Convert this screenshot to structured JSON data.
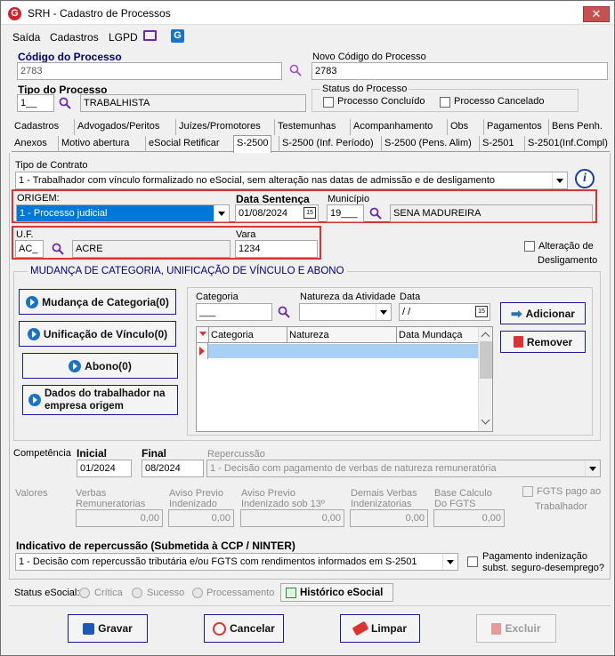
{
  "window": {
    "title": "SRH - Cadastro de Processos",
    "close_icon": "✕"
  },
  "menu": [
    "Saída",
    "Cadastros",
    "LGPD"
  ],
  "header": {
    "codigo_label": "Código do Processo",
    "codigo_value": "2783",
    "novo_codigo_label": "Novo Código do Processo",
    "novo_codigo_value": "2783",
    "tipo_label": "Tipo do Processo",
    "tipo_code": "1__",
    "tipo_desc": "TRABALHISTA",
    "status_label": "Status do Processo",
    "status_concluido": "Processo Concluído",
    "status_cancelado": "Processo Cancelado"
  },
  "tabs_row1": [
    "Cadastros",
    "Advogados/Peritos",
    "Juízes/Promotores",
    "Testemunhas",
    "Acompanhamento",
    "Obs",
    "Pagamentos",
    "Bens Penh."
  ],
  "tabs_row2": [
    "Anexos",
    "Motivo abertura",
    "eSocial Retificar",
    "S-2500",
    "S-2500 (Inf. Período)",
    "S-2500 (Pens. Alim)",
    "S-2501",
    "S-2501(Inf.Compl)"
  ],
  "active_tab": "S-2500",
  "s2500": {
    "tipo_contrato_label": "Tipo de Contrato",
    "tipo_contrato_value": "1 - Trabalhador com vínculo formalizado no eSocial, sem alteração nas datas de admissão e de desligamento",
    "origem_label": "ORIGEM:",
    "origem_value": "1 - Processo judicial",
    "data_sentenca_label": "Data Sentença",
    "data_sentenca_value": "01/08/2024",
    "municipio_label": "Município",
    "municipio_code": "19___",
    "municipio_name": "SENA MADUREIRA",
    "uf_label": "U.F.",
    "uf_code": "AC_",
    "uf_name": "ACRE",
    "vara_label": "Vara",
    "vara_value": "1234",
    "alteracao_label_1": "Alteração de",
    "alteracao_label_2": "Desligamento"
  },
  "mudanca": {
    "section_title": "MUDANÇA DE CATEGORIA, UNIFICAÇÃO DE VÍNCULO E ABONO",
    "btn_mudanca": "Mudança de Categoria(0)",
    "btn_unificacao": "Unificação de Vínculo(0)",
    "btn_abono": "Abono(0)",
    "btn_dados_1": "Dados do trabalhador na",
    "btn_dados_2": "empresa origem",
    "categoria_label": "Categoria",
    "categoria_value": "___",
    "natureza_label": "Natureza da Atividade",
    "data_label": "Data",
    "data_value": " / /",
    "btn_adicionar": "Adicionar",
    "btn_remover": "Remover",
    "grid_cols": [
      "Categoria",
      "Natureza",
      "Data Mundaça"
    ]
  },
  "competencia": {
    "label": "Competência",
    "inicial_label": "Inicial",
    "inicial_value": "01/2024",
    "final_label": "Final",
    "final_value": "08/2024",
    "repercussao_label": "Repercussão",
    "repercussao_value": "1 - Decisão com pagamento de verbas de natureza remuneratória"
  },
  "valores": {
    "label": "Valores",
    "verbas_1": "Verbas",
    "verbas_2": "Remuneratorias",
    "verbas_value": "0,00",
    "aviso_1": "Aviso Previo",
    "aviso_2": "Indenizado",
    "aviso_value": "0,00",
    "aviso13_1": "Aviso Previo",
    "aviso13_2": "Indenizado sob 13º",
    "aviso13_value": "0,00",
    "demais_1": "Demais Verbas",
    "demais_2": "Indenizatorias",
    "demais_value": "0,00",
    "base_1": "Base Calculo",
    "base_2": "Do FGTS",
    "base_value": "0,00",
    "fgts_1": "FGTS pago ao",
    "fgts_2": "Trabalhador"
  },
  "indicativo": {
    "label": "Indicativo de repercussão (Submetida à CCP / NINTER)",
    "value": "1 - Decisão com repercussão tributária e/ou FGTS com rendimentos informados em S-2501",
    "pag_1": "Pagamento indenização",
    "pag_2": "subst. seguro-desemprego?"
  },
  "status": {
    "label": "Status eSocial:",
    "critica": "Crítica",
    "sucesso": "Sucesso",
    "processamento": "Processamento",
    "historico": "Histórico eSocial"
  },
  "footer": {
    "gravar": "Gravar",
    "cancelar": "Cancelar",
    "limpar": "Limpar",
    "excluir": "Excluir"
  },
  "colors": {
    "accent": "#000080",
    "highlight": "#d93333",
    "selection": "#0078d7"
  }
}
